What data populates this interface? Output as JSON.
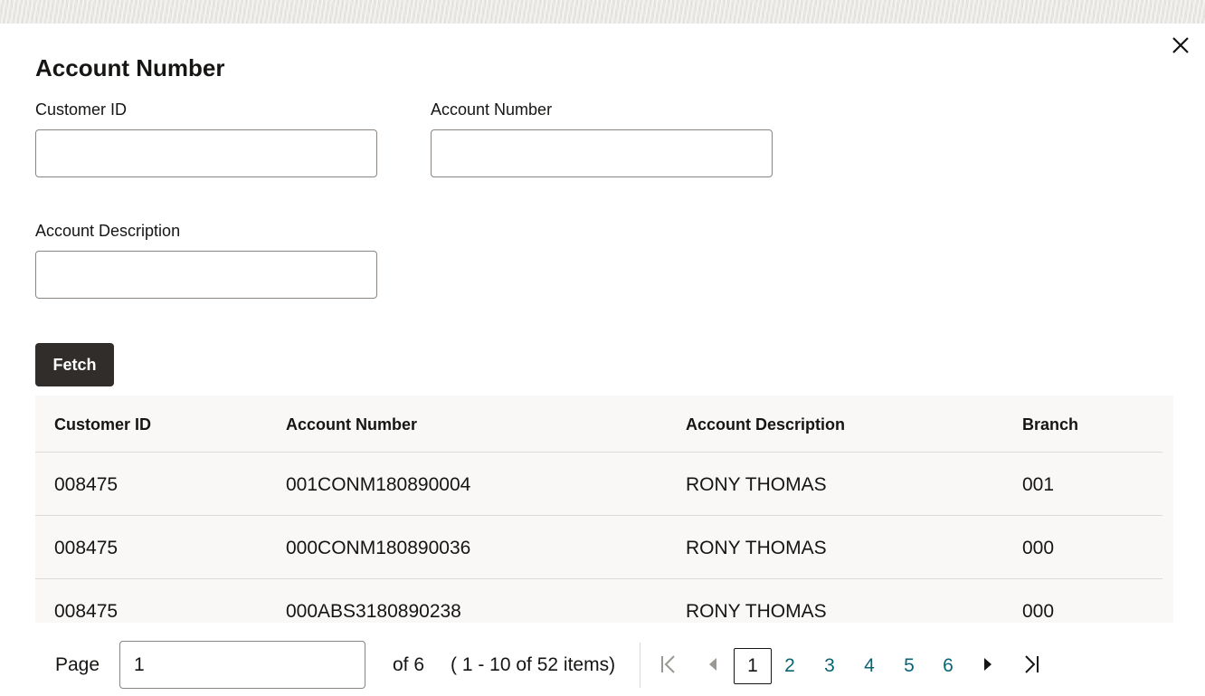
{
  "dialog": {
    "title": "Account Number",
    "close_icon": "close-icon"
  },
  "form": {
    "customer_id": {
      "label": "Customer ID",
      "value": ""
    },
    "account_number": {
      "label": "Account Number",
      "value": ""
    },
    "account_description": {
      "label": "Account Description",
      "value": ""
    },
    "fetch_label": "Fetch"
  },
  "table": {
    "columns": [
      "Customer ID",
      "Account Number",
      "Account Description",
      "Branch"
    ],
    "rows": [
      [
        "008475",
        "001CONM180890004",
        "RONY THOMAS",
        "001"
      ],
      [
        "008475",
        "000CONM180890036",
        "RONY THOMAS",
        "000"
      ],
      [
        "008475",
        "000ABS3180890238",
        "RONY THOMAS",
        "000"
      ]
    ]
  },
  "pagination": {
    "page_label": "Page",
    "current_page": "1",
    "of_pages": "of 6",
    "range_text": "( 1 - 10 of 52 items)",
    "pages": [
      "1",
      "2",
      "3",
      "4",
      "5",
      "6"
    ],
    "icons": {
      "first": "first-page-icon",
      "prev": "previous-page-icon",
      "next": "next-page-icon",
      "last": "last-page-icon"
    }
  },
  "colors": {
    "primary_button": "#312d2a",
    "link": "#0a6474",
    "table_bg": "#f9f8f6",
    "disabled_icon": "#9b9792"
  }
}
